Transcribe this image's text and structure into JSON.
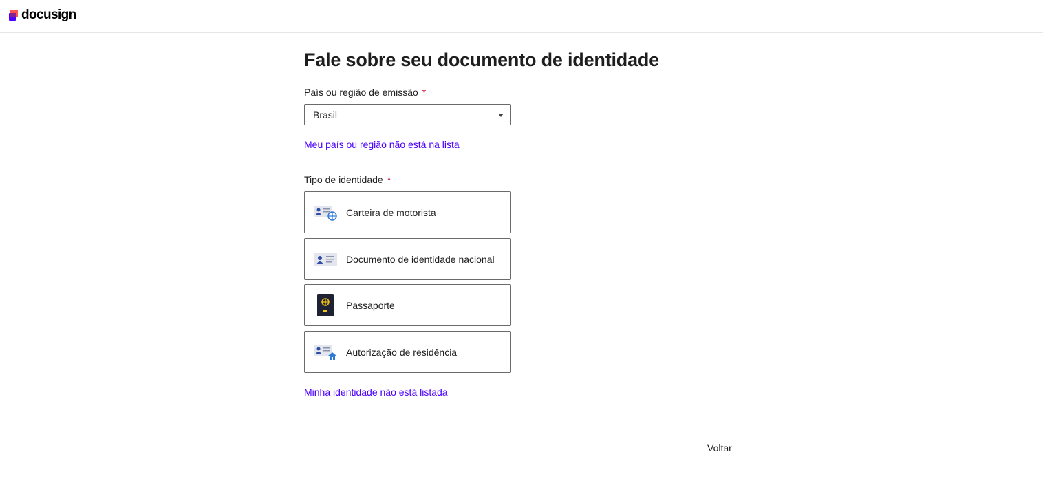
{
  "brand": {
    "name": "docusign",
    "accent": "#4c00ff",
    "logo_colors": [
      "#ff5252",
      "#4c00ff"
    ]
  },
  "page": {
    "title": "Fale sobre seu documento de identidade"
  },
  "country": {
    "label": "País ou região de emissão",
    "required_mark": "*",
    "selected": "Brasil",
    "not_listed_link": "Meu país ou região não está na lista"
  },
  "id_type": {
    "label": "Tipo de identidade",
    "required_mark": "*",
    "options": [
      {
        "label": "Carteira de motorista",
        "icon": "drivers-license-icon"
      },
      {
        "label": "Documento de identidade nacional",
        "icon": "national-id-card-icon"
      },
      {
        "label": "Passaporte",
        "icon": "passport-icon"
      },
      {
        "label": "Autorização de residência",
        "icon": "residence-permit-icon"
      }
    ],
    "not_listed_link": "Minha identidade não está listada"
  },
  "footer": {
    "back_label": "Voltar"
  },
  "colors": {
    "required": "#c8102e",
    "link": "#4c00ff",
    "border": "#6b6b6b"
  }
}
